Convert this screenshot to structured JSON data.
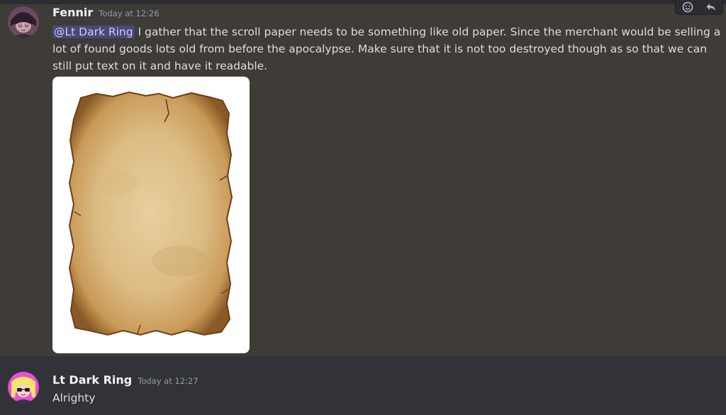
{
  "messages": [
    {
      "username": "Fennir",
      "timestamp": "Today at 12:26",
      "mention": "@Lt Dark Ring",
      "text": " I gather that the scroll paper needs to be something like old paper. Since the merchant would be selling a lot of found goods lots old from before the apocalypse. Make sure that it is not too destroyed though as so that we can still put text on it and have it readable.",
      "attachment": {
        "type": "image",
        "subject": "old-parchment-scroll"
      }
    },
    {
      "username": "Lt Dark Ring",
      "timestamp": "Today at 12:27",
      "text": "Alrighty"
    }
  ],
  "toolbar": {
    "icons": [
      "add-reaction-icon",
      "reply-icon"
    ]
  },
  "colors": {
    "background": "#313338",
    "highlighted_message": "#3f3b37",
    "text": "#dbdee1",
    "username": "#f2f3f5",
    "timestamp": "#949ba4",
    "mention_bg": "#5865f2"
  }
}
